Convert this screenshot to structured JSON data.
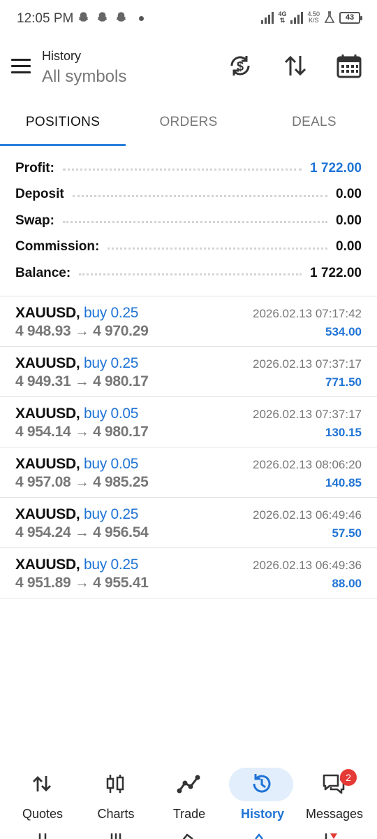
{
  "status_bar": {
    "time": "12:05 PM",
    "network": "4G",
    "speed_value": "4.50",
    "speed_unit": "K/S",
    "battery": "43",
    "icons": [
      "snapchat-icon",
      "snapchat-icon",
      "snapchat-icon",
      "signal-icon",
      "signal-icon",
      "flask-icon",
      "battery-icon"
    ]
  },
  "app_bar": {
    "title": "History",
    "subtitle": "All symbols",
    "icons": [
      "menu-icon",
      "currency-sync-icon",
      "sort-icon",
      "calendar-icon"
    ]
  },
  "tabs": [
    {
      "label": "POSITIONS",
      "active": true
    },
    {
      "label": "ORDERS",
      "active": false
    },
    {
      "label": "DEALS",
      "active": false
    }
  ],
  "summary": [
    {
      "label": "Profit:",
      "value": "1 722.00",
      "highlight": true
    },
    {
      "label": "Deposit",
      "value": "0.00",
      "highlight": false
    },
    {
      "label": "Swap:",
      "value": "0.00",
      "highlight": false
    },
    {
      "label": "Commission:",
      "value": "0.00",
      "highlight": false
    },
    {
      "label": "Balance:",
      "value": "1 722.00",
      "highlight": false
    }
  ],
  "positions": [
    {
      "symbol": "XAUUSD,",
      "side": "buy 0.25",
      "prices": "4 948.93 → 4 970.29",
      "time": "2026.02.13 07:17:42",
      "profit": "534.00"
    },
    {
      "symbol": "XAUUSD,",
      "side": "buy 0.25",
      "prices": "4 949.31 → 4 980.17",
      "time": "2026.02.13 07:37:17",
      "profit": "771.50"
    },
    {
      "symbol": "XAUUSD,",
      "side": "buy 0.05",
      "prices": "4 954.14 → 4 980.17",
      "time": "2026.02.13 07:37:17",
      "profit": "130.15"
    },
    {
      "symbol": "XAUUSD,",
      "side": "buy 0.05",
      "prices": "4 957.08 → 4 985.25",
      "time": "2026.02.13 08:06:20",
      "profit": "140.85"
    },
    {
      "symbol": "XAUUSD,",
      "side": "buy 0.25",
      "prices": "4 954.24 → 4 956.54",
      "time": "2026.02.13 06:49:46",
      "profit": "57.50"
    },
    {
      "symbol": "XAUUSD,",
      "side": "buy 0.25",
      "prices": "4 951.89 → 4 955.41",
      "time": "2026.02.13 06:49:36",
      "profit": "88.00"
    }
  ],
  "bottom_nav": [
    {
      "label": "Quotes",
      "icon": "quotes-arrows-icon",
      "active": false
    },
    {
      "label": "Charts",
      "icon": "candlestick-icon",
      "active": false
    },
    {
      "label": "Trade",
      "icon": "trade-line-icon",
      "active": false
    },
    {
      "label": "History",
      "icon": "history-clock-icon",
      "active": true
    },
    {
      "label": "Messages",
      "icon": "chat-bubbles-icon",
      "active": false,
      "badge": "2"
    }
  ],
  "colors": {
    "accent": "#1f74d6",
    "tab_indicator": "#2a7fde",
    "active_nav_bg": "#e2eefb",
    "badge": "#e53935",
    "muted_text": "#777777"
  }
}
